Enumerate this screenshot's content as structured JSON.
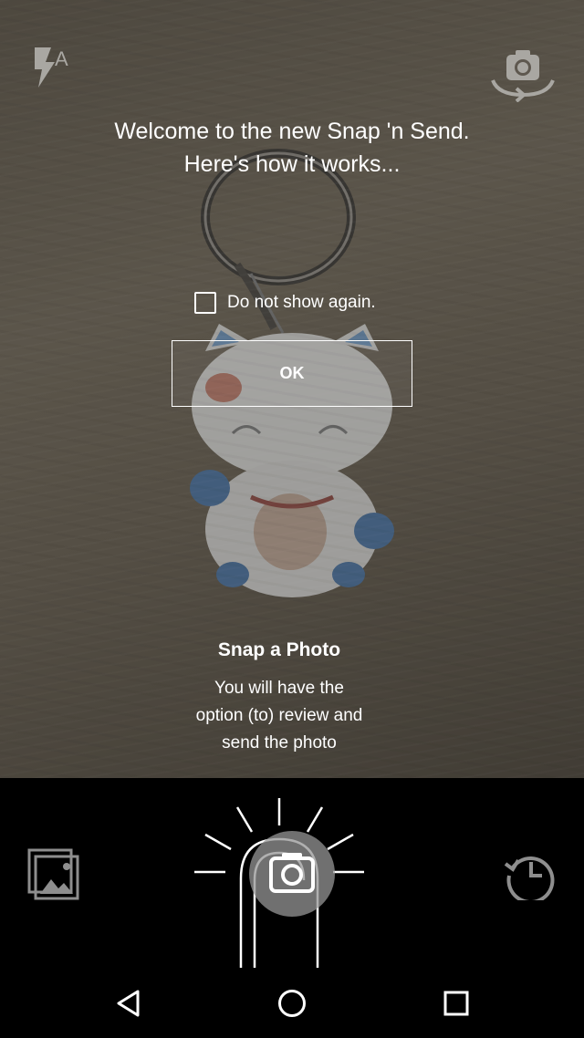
{
  "onboarding": {
    "welcome_line1": "Welcome to the new Snap 'n Send.",
    "welcome_line2": "Here's how it works...",
    "checkbox_label": "Do not show again.",
    "checkbox_checked": false,
    "ok_label": "OK",
    "tip_title": "Snap a Photo",
    "tip_line1": "You will have the",
    "tip_line2": "option (to) review and",
    "tip_line3": "send the photo"
  },
  "toolbar": {
    "flash_icon": "flash-auto-icon",
    "flash_mode_letter": "A",
    "switch_camera_icon": "switch-camera-icon"
  },
  "controls": {
    "gallery_icon": "gallery-icon",
    "shutter_icon": "camera-shutter-icon",
    "history_icon": "history-icon"
  },
  "navbar": {
    "back_icon": "back-triangle-icon",
    "home_icon": "home-circle-icon",
    "recent_icon": "recent-apps-square-icon"
  },
  "colors": {
    "overlay_text": "#ffffff",
    "controls_background": "#000000",
    "shutter": "#969696"
  }
}
